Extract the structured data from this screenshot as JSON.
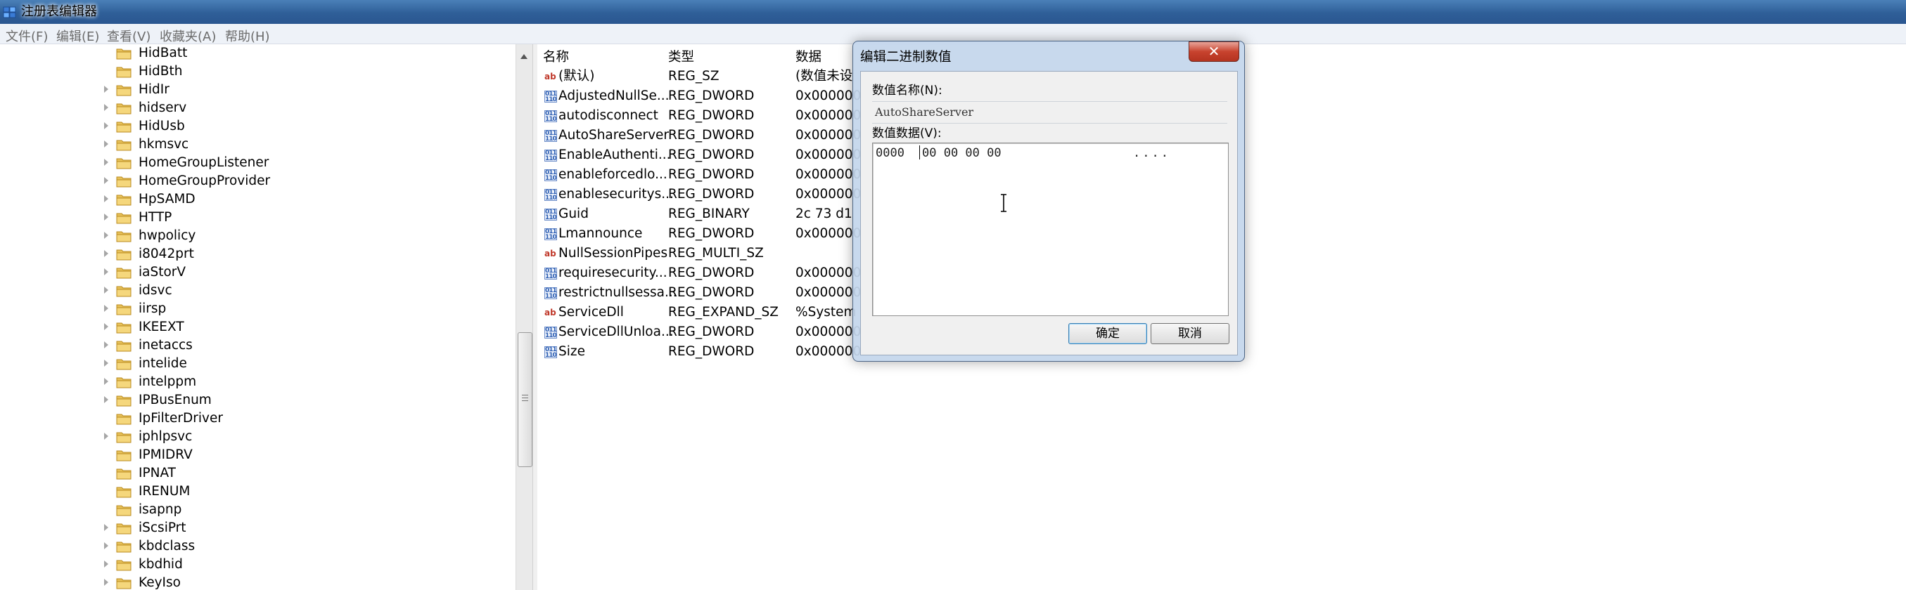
{
  "window": {
    "title": "注册表编辑器"
  },
  "menu": [
    "文件(F)",
    "编辑(E)",
    "查看(V)",
    "收藏夹(A)",
    "帮助(H)"
  ],
  "tree": {
    "items": [
      {
        "label": "HidBatt",
        "expandable": false
      },
      {
        "label": "HidBth",
        "expandable": false
      },
      {
        "label": "HidIr",
        "expandable": true
      },
      {
        "label": "hidserv",
        "expandable": true
      },
      {
        "label": "HidUsb",
        "expandable": true
      },
      {
        "label": "hkmsvc",
        "expandable": true
      },
      {
        "label": "HomeGroupListener",
        "expandable": true
      },
      {
        "label": "HomeGroupProvider",
        "expandable": true
      },
      {
        "label": "HpSAMD",
        "expandable": true
      },
      {
        "label": "HTTP",
        "expandable": true
      },
      {
        "label": "hwpolicy",
        "expandable": true
      },
      {
        "label": "i8042prt",
        "expandable": true
      },
      {
        "label": "iaStorV",
        "expandable": true
      },
      {
        "label": "idsvc",
        "expandable": true
      },
      {
        "label": "iirsp",
        "expandable": true
      },
      {
        "label": "IKEEXT",
        "expandable": true
      },
      {
        "label": "inetaccs",
        "expandable": true
      },
      {
        "label": "intelide",
        "expandable": true
      },
      {
        "label": "intelppm",
        "expandable": true
      },
      {
        "label": "IPBusEnum",
        "expandable": true
      },
      {
        "label": "IpFilterDriver",
        "expandable": false
      },
      {
        "label": "iphlpsvc",
        "expandable": true
      },
      {
        "label": "IPMIDRV",
        "expandable": false
      },
      {
        "label": "IPNAT",
        "expandable": false
      },
      {
        "label": "IRENUM",
        "expandable": false
      },
      {
        "label": "isapnp",
        "expandable": false
      },
      {
        "label": "iScsiPrt",
        "expandable": true
      },
      {
        "label": "kbdclass",
        "expandable": true
      },
      {
        "label": "kbdhid",
        "expandable": true
      },
      {
        "label": "KeyIso",
        "expandable": true
      }
    ]
  },
  "list": {
    "headers": {
      "name": "名称",
      "type": "类型",
      "data": "数据"
    },
    "rows": [
      {
        "icon": "string-value-icon",
        "name": "(默认)",
        "type": "REG_SZ",
        "data": "(数值未设"
      },
      {
        "icon": "binary-value-icon",
        "name": "AdjustedNullSe...",
        "type": "REG_DWORD",
        "data": "0x000000"
      },
      {
        "icon": "binary-value-icon",
        "name": "autodisconnect",
        "type": "REG_DWORD",
        "data": "0x000000"
      },
      {
        "icon": "binary-value-icon",
        "name": "AutoShareServer",
        "type": "REG_DWORD",
        "data": "0x000000"
      },
      {
        "icon": "binary-value-icon",
        "name": "EnableAuthenti...",
        "type": "REG_DWORD",
        "data": "0x000000"
      },
      {
        "icon": "binary-value-icon",
        "name": "enableforcedlo...",
        "type": "REG_DWORD",
        "data": "0x000000"
      },
      {
        "icon": "binary-value-icon",
        "name": "enablesecuritys...",
        "type": "REG_DWORD",
        "data": "0x000000"
      },
      {
        "icon": "binary-value-icon",
        "name": "Guid",
        "type": "REG_BINARY",
        "data": "2c 73 d1"
      },
      {
        "icon": "binary-value-icon",
        "name": "Lmannounce",
        "type": "REG_DWORD",
        "data": "0x000000"
      },
      {
        "icon": "string-value-icon",
        "name": "NullSessionPipes",
        "type": "REG_MULTI_SZ",
        "data": ""
      },
      {
        "icon": "binary-value-icon",
        "name": "requiresecurity...",
        "type": "REG_DWORD",
        "data": "0x000000"
      },
      {
        "icon": "binary-value-icon",
        "name": "restrictnullsessa...",
        "type": "REG_DWORD",
        "data": "0x000000"
      },
      {
        "icon": "string-value-icon",
        "name": "ServiceDll",
        "type": "REG_EXPAND_SZ",
        "data": "%System"
      },
      {
        "icon": "binary-value-icon",
        "name": "ServiceDllUnloa...",
        "type": "REG_DWORD",
        "data": "0x000000"
      },
      {
        "icon": "binary-value-icon",
        "name": "Size",
        "type": "REG_DWORD",
        "data": "0x000000"
      }
    ]
  },
  "dialog": {
    "title": "编辑二进制数值",
    "name_label": "数值名称(N):",
    "name_value": "AutoShareServer",
    "data_label": "数值数据(V):",
    "hex": {
      "address": "0000",
      "bytes": "00 00 00 00",
      "ascii": "...."
    },
    "ok_label": "确定",
    "cancel_label": "取消",
    "close_label": "✕"
  }
}
